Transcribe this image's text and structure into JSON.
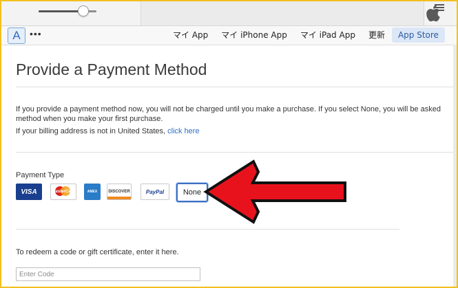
{
  "topbar": {
    "volume_level": 0.78,
    "apple_logo": "apple-logo-icon",
    "list_icon": "list-icon"
  },
  "navbar": {
    "store_icon": "app-store-icon",
    "store_icon_glyph": "A",
    "more_glyph": "•••",
    "tabs": [
      {
        "label": "マイ App"
      },
      {
        "label": "マイ iPhone App"
      },
      {
        "label": "マイ iPad App"
      },
      {
        "label": "更新"
      },
      {
        "label": "App Store",
        "active": true
      }
    ]
  },
  "page": {
    "title": "Provide a Payment Method",
    "intro_line1": "If you provide a payment method now, you will not be charged until you make a purchase. If you select None, you will be asked",
    "intro_line2": "method when you make your first purchase.",
    "billing_text": "If your billing address is not in United States, ",
    "billing_link": "click here",
    "payment_type_label": "Payment Type",
    "cards": [
      {
        "name": "VISA",
        "label": "VISA"
      },
      {
        "name": "MasterCard",
        "label": "MasterCard"
      },
      {
        "name": "American Express",
        "label": "AMEX"
      },
      {
        "name": "Discover",
        "label": "DISCOVER"
      },
      {
        "name": "PayPal",
        "label": "PayPal"
      }
    ],
    "none_label": "None",
    "redeem_text": "To redeem a code or gift certificate, enter it here.",
    "code_placeholder": "Enter Code"
  },
  "colors": {
    "accent": "#2b6fc6",
    "arrow_fill": "#e8121c",
    "frame_border": "#f2c020"
  }
}
